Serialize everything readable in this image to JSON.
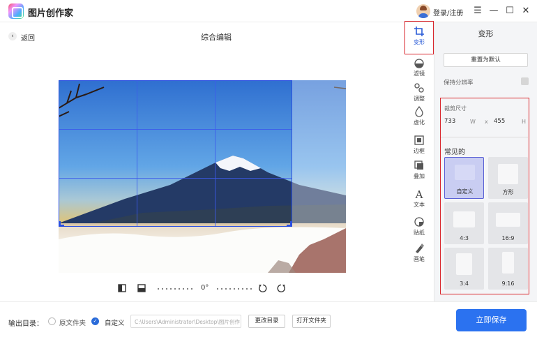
{
  "app": {
    "title": "图片创作家"
  },
  "account": {
    "login_label": "登录/注册"
  },
  "window": {
    "menu": "☰",
    "minimize": "—",
    "maximize": "☐",
    "close": "✕"
  },
  "topbar": {
    "back_label": "返回",
    "page_title": "综合编辑"
  },
  "editor": {
    "angle": "0°"
  },
  "toolbar": {
    "items": [
      {
        "label": "变形",
        "icon": "crop-icon",
        "active": true
      },
      {
        "label": "滤镜",
        "icon": "filter-icon"
      },
      {
        "label": "调整",
        "icon": "adjust-icon"
      },
      {
        "label": "虚化",
        "icon": "blur-icon"
      },
      {
        "label": "边框",
        "icon": "frame-icon"
      },
      {
        "label": "叠加",
        "icon": "overlay-icon"
      },
      {
        "label": "文本",
        "icon": "text-icon"
      },
      {
        "label": "贴纸",
        "icon": "sticker-icon"
      },
      {
        "label": "画笔",
        "icon": "brush-icon"
      }
    ]
  },
  "panel": {
    "title": "变形",
    "reset_label": "重置为默认",
    "keep_ratio_label": "保持分辨率",
    "crop_size_label": "裁剪尺寸",
    "width_value": "733",
    "width_unit": "W",
    "times": "x",
    "height_value": "455",
    "height_unit": "H",
    "common_label": "常见的",
    "presets": [
      {
        "label": "自定义",
        "selected": true
      },
      {
        "label": "方形"
      },
      {
        "label": "4:3"
      },
      {
        "label": "16:9"
      },
      {
        "label": "3:4"
      },
      {
        "label": "9:16"
      }
    ]
  },
  "bottom": {
    "output_label": "输出目录：",
    "option_original": "原文件夹",
    "option_custom": "自定义",
    "path_value": "C:\\Users\\Administrator\\Desktop\\图片创作",
    "change_dir_label": "更改目录",
    "open_folder_label": "打开文件夹",
    "save_label": "立即保存"
  },
  "colors": {
    "accent": "#2b72f0",
    "highlight_border": "#d9262c",
    "crop_grid": "#2a4fe0",
    "selected_preset": "#c9cdf2"
  }
}
